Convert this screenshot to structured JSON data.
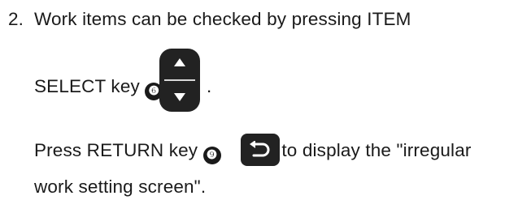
{
  "step": {
    "number": "2.",
    "line1": "Work items can be checked by pressing ITEM",
    "line2": "SELECT key",
    "key1_symbol": "❻",
    "period": ".",
    "line3a": "Press RETURN key",
    "key2_symbol": "❾",
    "line3b": "to display the \"irregular",
    "line4": "work setting screen\"."
  },
  "icons": {
    "item_select_key": "up-down-arrow-key-icon",
    "return_key": "return-arrow-key-icon"
  },
  "colors": {
    "text": "#1a1a1a",
    "key_background": "#222222",
    "key_symbol": "#ffffff"
  }
}
